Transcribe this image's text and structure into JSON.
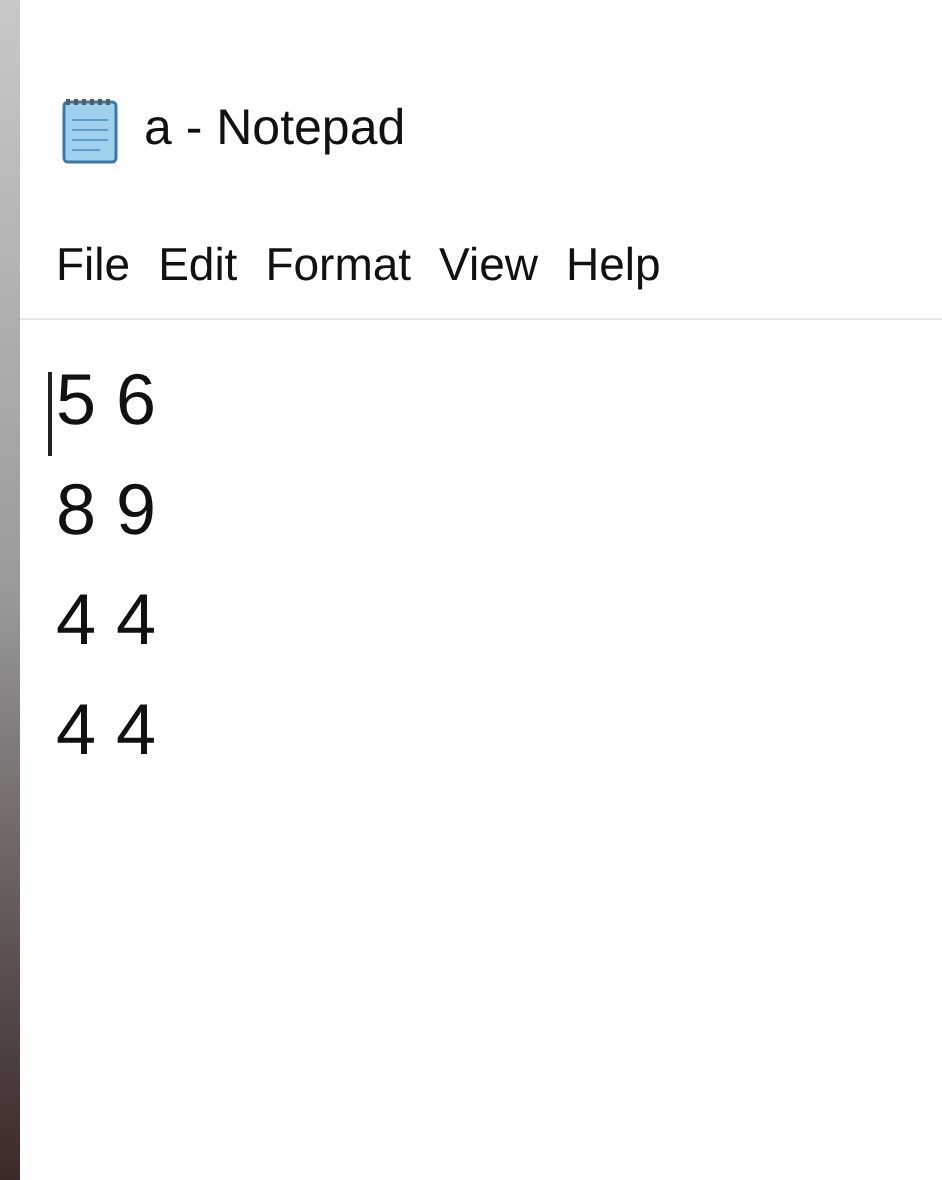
{
  "window": {
    "title": "a - Notepad"
  },
  "menu": [
    "File",
    "Edit",
    "Format",
    "View",
    "Help"
  ],
  "document": {
    "lines": [
      "5 6",
      "8 9",
      "4 4",
      "4 4"
    ]
  }
}
